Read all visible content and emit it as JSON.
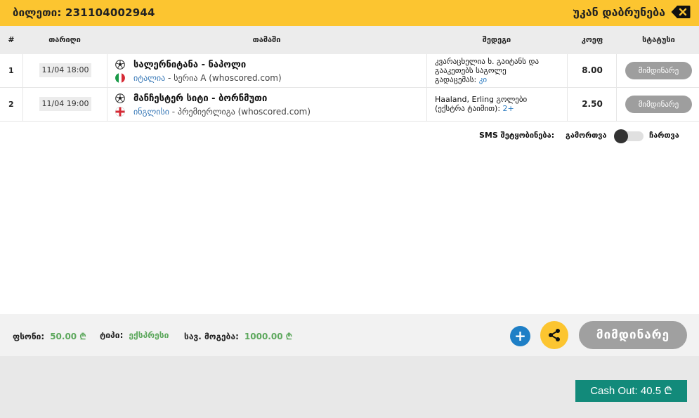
{
  "header": {
    "ticket_label": "ბილეთი: 231104002944",
    "back_label": "უკან დაბრუნება",
    "back_icon": "backspace-icon"
  },
  "table": {
    "columns": [
      "#",
      "თარიღი",
      "თამაში",
      "შედეგი",
      "კოეფ",
      "სტატუსი"
    ],
    "rows": [
      {
        "num": "1",
        "date": "11/04 18:00",
        "match": "სალერნიტანა - ნაპოლი",
        "country": "იტალია",
        "league": " - სერია A (whoscored.com)",
        "outcome_lines": [
          "კვარაცხელია ხ. გაიტანს და",
          "გააკეთებს საგოლე",
          "გადაცემას: "
        ],
        "outcome_value": "კი",
        "odds": "8.00",
        "status": "მიმდინარე",
        "flag": "italy-flag-icon"
      },
      {
        "num": "2",
        "date": "11/04 19:00",
        "match": "მანჩესტერ სიტი - ბორნმუთი",
        "country": "ინგლისი",
        "league": " - პრემიერლიგა (whoscored.com)",
        "outcome_lines": [
          "Haaland, Erling გოლები",
          "(ექსტრა ტაიმით): "
        ],
        "outcome_value": "2+",
        "odds": "2.50",
        "status": "მიმდინარე",
        "flag": "england-flag-icon"
      }
    ]
  },
  "sms": {
    "label": "SMS შეტყობინება:",
    "off_label": "გამორთვა",
    "on_label": "ჩართვა",
    "enabled": false
  },
  "footer": {
    "stake_label": "ფსონი:",
    "stake_value": "50.00 ₾",
    "type_label": "ტიპი:",
    "type_value": "ექსპრესი",
    "win_label": "სავ. მოგება:",
    "win_value": "1000.00 ₾",
    "plus_label": "+",
    "status_label": "მიმდინარე"
  },
  "cashout": {
    "label": "Cash Out: 40.5 ₾"
  },
  "colors": {
    "accent": "#fcc530",
    "pill": "#9e9e9e",
    "value_green": "#5da85d",
    "link_blue": "#2a7ac0",
    "cashout_teal": "#128a7a"
  }
}
